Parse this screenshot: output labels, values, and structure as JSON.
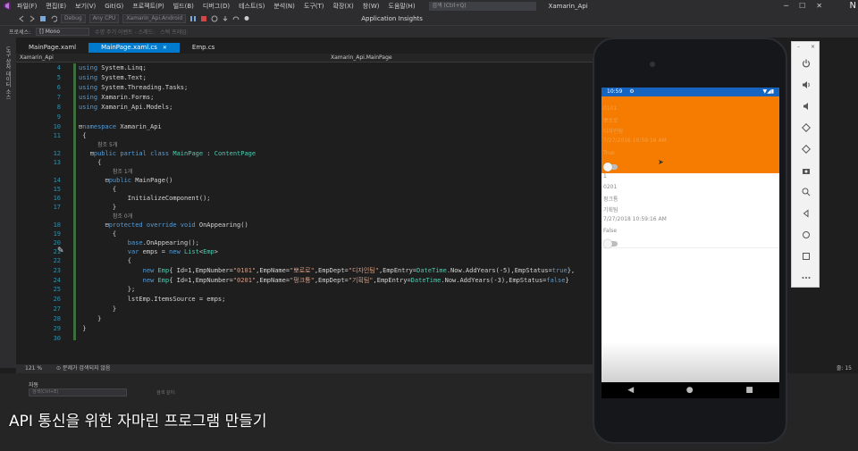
{
  "menubar": {
    "items": [
      "파일(F)",
      "편집(E)",
      "보기(V)",
      "Git(G)",
      "프로젝트(P)",
      "빌드(B)",
      "디버그(D)",
      "테스트(S)",
      "분석(N)",
      "도구(T)",
      "확장(X)",
      "창(W)",
      "도움말(H)"
    ],
    "search_placeholder": "검색 (Ctrl+Q)",
    "window_title": "Xamarin_Api",
    "right_badge": "N"
  },
  "toolbar": {
    "config": "Debug",
    "platform": "Any CPU",
    "project": "Xamarin_Api.Android",
    "app_insights": "Application Insights"
  },
  "procbar": {
    "label": "프로세스:",
    "process": "[] Mono",
    "event_label": "수명 주기 이벤트 - 스레드:",
    "stack_label": "스택 프레임:"
  },
  "leftstrip": {
    "label": "도구 상자 데이터 소스"
  },
  "tabs": [
    {
      "label": "MainPage.xaml",
      "active": false
    },
    {
      "label": "MainPage.xaml.cs",
      "active": true
    },
    {
      "label": "Emp.cs",
      "active": false
    }
  ],
  "navbar": {
    "left": "Xamarin_Api",
    "mid": "Xamarin_Api.MainPage"
  },
  "code": {
    "line_numbers": [
      "4",
      "5",
      "6",
      "7",
      "8",
      "9",
      "10",
      "11",
      "",
      "12",
      "13",
      "",
      "14",
      "15",
      "16",
      "17",
      "",
      "18",
      "19",
      "20",
      "21",
      "22",
      "23",
      "24",
      "25",
      "26",
      "27",
      "28",
      "29",
      "30"
    ],
    "refs": {
      "r5": "참조 5개",
      "r1": "참조 1개",
      "r0": "참조 0개"
    }
  },
  "status": {
    "zoom": "121 %",
    "issues": "문제가 검색되지 않음",
    "line": "줄: 15"
  },
  "bottom": {
    "title": "자동",
    "search": "검색(Ctrl+E)",
    "depth": "검색 깊이:"
  },
  "caption": "API 통신을 위한 자마린 프로그램 만들기",
  "phone": {
    "time": "10:59",
    "items": [
      {
        "number": "0101",
        "name": "뽀로로",
        "dept": "디자인팀",
        "entry": "7/27/2016 10:59:16 AM",
        "status": "True"
      },
      {
        "number": "0201",
        "name": "펑크툥",
        "dept": "기획팀",
        "entry": "7/27/2018 10:59:16 AM",
        "status": "False"
      }
    ],
    "id_value": "1"
  },
  "colors": {
    "accent": "#007acc",
    "item_bg": "#f57c00",
    "statusbar": "#1565c0"
  }
}
